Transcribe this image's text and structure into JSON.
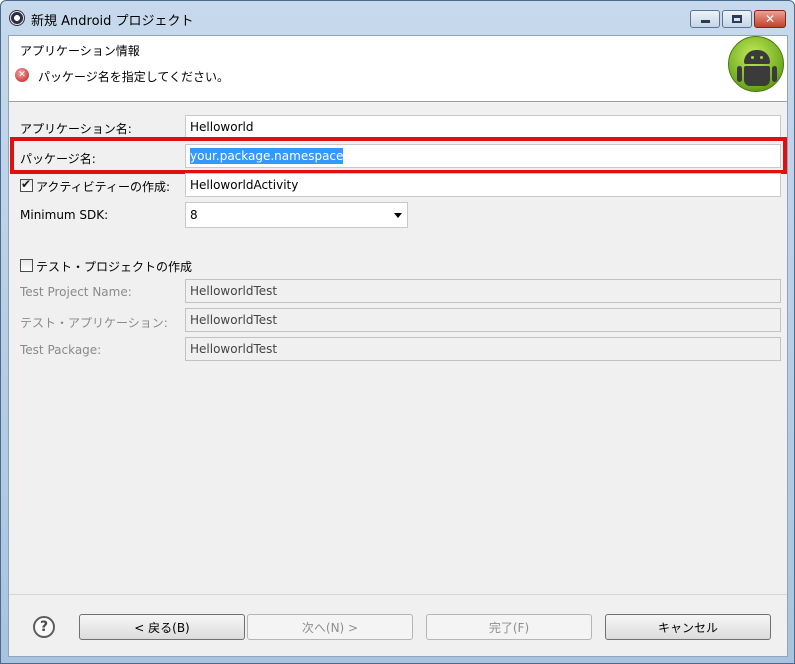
{
  "window": {
    "title": "新規 Android プロジェクト"
  },
  "header": {
    "title": "アプリケーション情報",
    "error_message": "パッケージ名を指定してください。"
  },
  "form": {
    "app_name": {
      "label": "アプリケーション名:",
      "value": "Helloworld"
    },
    "package_name": {
      "label": "パッケージ名:",
      "value": "your.package.namespace"
    },
    "create_activity": {
      "label": "アクティビティーの作成:",
      "value": "HelloworldActivity",
      "checked": true
    },
    "min_sdk": {
      "label": "Minimum SDK:",
      "value": "8"
    },
    "create_test": {
      "label": "テスト・プロジェクトの作成",
      "checked": false
    },
    "test_project_name": {
      "label": "Test Project Name:",
      "value": "HelloworldTest"
    },
    "test_application": {
      "label": "テスト・アプリケーション:",
      "value": "HelloworldTest"
    },
    "test_package": {
      "label": "Test Package:",
      "value": "HelloworldTest"
    }
  },
  "buttons": {
    "back": "< 戻る(B)",
    "next": "次へ(N) >",
    "finish": "完了(F)",
    "cancel": "キャンセル"
  },
  "colors": {
    "highlight_border": "#e01010",
    "selection": "#3399ff"
  },
  "icons": {
    "error": "error-icon",
    "help": "help-icon",
    "logo": "android-logo"
  }
}
